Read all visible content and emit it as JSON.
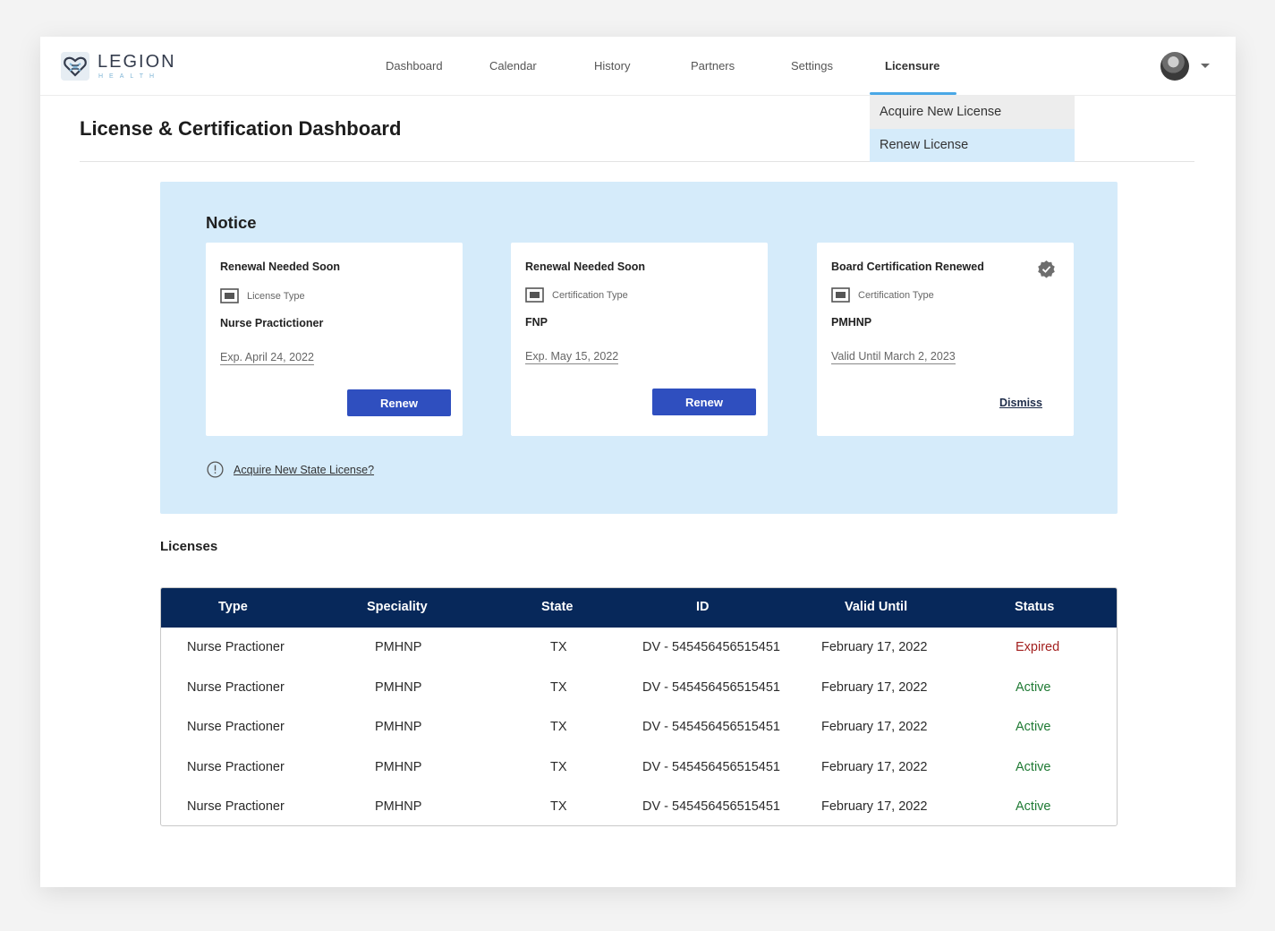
{
  "app": {
    "logo_word": "LEGION",
    "logo_sub": "HEALTH"
  },
  "nav": {
    "items": [
      {
        "label": "Dashboard"
      },
      {
        "label": "Calendar"
      },
      {
        "label": "History"
      },
      {
        "label": "Partners"
      },
      {
        "label": "Settings"
      },
      {
        "label": "Licensure"
      }
    ],
    "active": "Licensure"
  },
  "dropdown": {
    "items": [
      {
        "label": "Acquire New License"
      },
      {
        "label": "Renew License"
      }
    ]
  },
  "page": {
    "title": "License & Certification Dashboard"
  },
  "notice": {
    "title": "Notice",
    "cards": [
      {
        "heading": "Renewal Needed Soon",
        "type_label": "License Type",
        "value": "Nurse Practictioner",
        "date": "Exp. April 24, 2022",
        "action": "Renew"
      },
      {
        "heading": "Renewal Needed Soon",
        "type_label": "Certification Type",
        "value": "FNP",
        "date": "Exp. May 15, 2022",
        "action": "Renew"
      },
      {
        "heading": "Board Certification Renewed",
        "type_label": "Certification Type",
        "value": "PMHNP",
        "date": "Valid Until March 2, 2023",
        "action": "Dismiss"
      }
    ],
    "acquire_link": "Acquire New State License?"
  },
  "licenses": {
    "title": "Licenses",
    "columns": [
      "Type",
      "Speciality",
      "State",
      "ID",
      "Valid Until",
      "Status"
    ],
    "rows": [
      [
        "Nurse Practioner",
        "PMHNP",
        "TX",
        "DV - 545456456515451",
        "February 17, 2022",
        "Expired"
      ],
      [
        "Nurse Practioner",
        "PMHNP",
        "TX",
        "DV - 545456456515451",
        "February 17, 2022",
        "Active"
      ],
      [
        "Nurse Practioner",
        "PMHNP",
        "TX",
        "DV - 545456456515451",
        "February 17, 2022",
        "Active"
      ],
      [
        "Nurse Practioner",
        "PMHNP",
        "TX",
        "DV - 545456456515451",
        "February 17, 2022",
        "Active"
      ],
      [
        "Nurse Practioner",
        "PMHNP",
        "TX",
        "DV - 545456456515451",
        "February 17, 2022",
        "Active"
      ]
    ]
  },
  "colors": {
    "primary_button": "#2f4fbf",
    "table_header": "#07285a",
    "notice_bg": "#d5ebfa",
    "status_expired": "#a3201f",
    "status_active": "#1f7a34",
    "nav_accent": "#4aa8e6"
  },
  "icons": {
    "logo": "heart-logo-icon",
    "type": "id-card-icon",
    "verified": "verified-check-icon",
    "info": "info-circle-icon",
    "caret": "chevron-down-icon"
  }
}
